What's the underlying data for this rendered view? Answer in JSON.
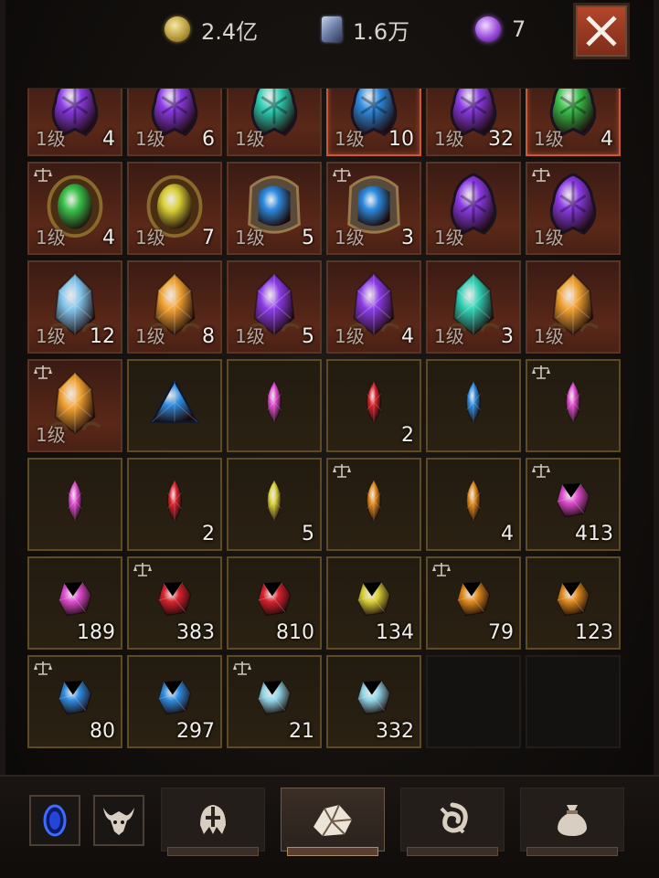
{
  "currency": [
    {
      "name": "gold",
      "icon": "gold-coin-icon",
      "value": "2.4亿"
    },
    {
      "name": "shard",
      "icon": "platinum-shard-icon",
      "value": "1.6万"
    },
    {
      "name": "orb",
      "icon": "purple-orb-icon",
      "value": "7"
    }
  ],
  "level_label": "1级",
  "rows": [
    [
      {
        "kind": "equip",
        "level": true,
        "qty": "4",
        "art": "purple-crest"
      },
      {
        "kind": "equip",
        "level": true,
        "qty": "6",
        "art": "purple-crest"
      },
      {
        "kind": "equip",
        "level": true,
        "qty": "",
        "art": "teal-crest"
      },
      {
        "kind": "equip",
        "level": true,
        "qty": "10",
        "art": "blue-crest",
        "highlight": true
      },
      {
        "kind": "equip",
        "level": true,
        "qty": "32",
        "art": "purple-crest"
      },
      {
        "kind": "equip",
        "level": true,
        "qty": "4",
        "art": "green-crest",
        "highlight": true
      }
    ],
    [
      {
        "kind": "equip",
        "level": true,
        "qty": "4",
        "art": "green-egg",
        "tradable": true
      },
      {
        "kind": "equip",
        "level": true,
        "qty": "7",
        "art": "yellow-egg"
      },
      {
        "kind": "equip",
        "level": true,
        "qty": "5",
        "art": "blue-rune-stone"
      },
      {
        "kind": "equip",
        "level": true,
        "qty": "3",
        "art": "blue-rune-stone",
        "tradable": true
      },
      {
        "kind": "equip",
        "level": true,
        "qty": "",
        "art": "violet-claw"
      },
      {
        "kind": "equip",
        "level": true,
        "qty": "",
        "art": "violet-claw",
        "tradable": true
      }
    ],
    [
      {
        "kind": "equip",
        "level": true,
        "qty": "12",
        "art": "ice-crystal"
      },
      {
        "kind": "equip",
        "level": true,
        "qty": "8",
        "art": "amber-shard"
      },
      {
        "kind": "equip",
        "level": true,
        "qty": "5",
        "art": "violet-crystal"
      },
      {
        "kind": "equip",
        "level": true,
        "qty": "4",
        "art": "violet-shard"
      },
      {
        "kind": "equip",
        "level": true,
        "qty": "3",
        "art": "teal-shard"
      },
      {
        "kind": "equip",
        "level": true,
        "qty": "",
        "art": "amber-cluster"
      }
    ],
    [
      {
        "kind": "equip",
        "level": true,
        "qty": "",
        "art": "amber-cluster",
        "tradable": true
      },
      {
        "kind": "gem",
        "level": false,
        "qty": "",
        "art": "blue-triangle"
      },
      {
        "kind": "gem",
        "level": false,
        "qty": "",
        "art": "pink-marquise"
      },
      {
        "kind": "gem",
        "level": false,
        "qty": "2",
        "art": "red-marquise"
      },
      {
        "kind": "gem",
        "level": false,
        "qty": "",
        "art": "blue-marquise"
      },
      {
        "kind": "gem",
        "level": false,
        "qty": "",
        "art": "pink-marquise",
        "tradable": true
      }
    ],
    [
      {
        "kind": "gem",
        "level": false,
        "qty": "",
        "art": "pink-marquise"
      },
      {
        "kind": "gem",
        "level": false,
        "qty": "2",
        "art": "red-marquise"
      },
      {
        "kind": "gem",
        "level": false,
        "qty": "5",
        "art": "yellow-marquise"
      },
      {
        "kind": "gem",
        "level": false,
        "qty": "",
        "art": "orange-marquise",
        "tradable": true
      },
      {
        "kind": "gem",
        "level": false,
        "qty": "4",
        "art": "orange-marquise"
      },
      {
        "kind": "gem",
        "level": false,
        "qty": "413",
        "art": "pink-chip",
        "tradable": true
      }
    ],
    [
      {
        "kind": "gem",
        "level": false,
        "qty": "189",
        "art": "pink-chip"
      },
      {
        "kind": "gem",
        "level": false,
        "qty": "383",
        "art": "red-chip",
        "tradable": true
      },
      {
        "kind": "gem",
        "level": false,
        "qty": "810",
        "art": "red-chip"
      },
      {
        "kind": "gem",
        "level": false,
        "qty": "134",
        "art": "yellow-chip"
      },
      {
        "kind": "gem",
        "level": false,
        "qty": "79",
        "art": "orange-chip",
        "tradable": true
      },
      {
        "kind": "gem",
        "level": false,
        "qty": "123",
        "art": "orange-chip"
      }
    ],
    [
      {
        "kind": "gem",
        "level": false,
        "qty": "80",
        "art": "blue-chip",
        "tradable": true
      },
      {
        "kind": "gem",
        "level": false,
        "qty": "297",
        "art": "blue-chip"
      },
      {
        "kind": "gem",
        "level": false,
        "qty": "21",
        "art": "cyan-chip",
        "tradable": true
      },
      {
        "kind": "gem",
        "level": false,
        "qty": "332",
        "art": "cyan-chip"
      },
      {
        "kind": "empty"
      },
      {
        "kind": "empty"
      }
    ]
  ],
  "bottom": {
    "small": [
      {
        "name": "portal-button",
        "icon": "blue-portal-icon"
      },
      {
        "name": "clan-button",
        "icon": "bull-emblem-icon"
      }
    ],
    "tabs": [
      {
        "name": "tab-armor",
        "icon": "helmet-icon",
        "active": false
      },
      {
        "name": "tab-gems",
        "icon": "gem-pouch-icon",
        "active": true
      },
      {
        "name": "tab-consumables",
        "icon": "swirl-rune-icon",
        "active": false
      },
      {
        "name": "tab-bag",
        "icon": "coin-bag-icon",
        "active": false
      }
    ]
  },
  "colors": {
    "pink": "#e04bd0",
    "red": "#d8222c",
    "yellow": "#d9cf36",
    "orange": "#e08a1c",
    "blue": "#2e8be0",
    "cyan": "#8fd6e8",
    "violet": "#8a3ae6",
    "teal": "#2fd0b4",
    "green": "#39c24a",
    "amber": "#f0a030",
    "ice": "#7fc3ea"
  }
}
